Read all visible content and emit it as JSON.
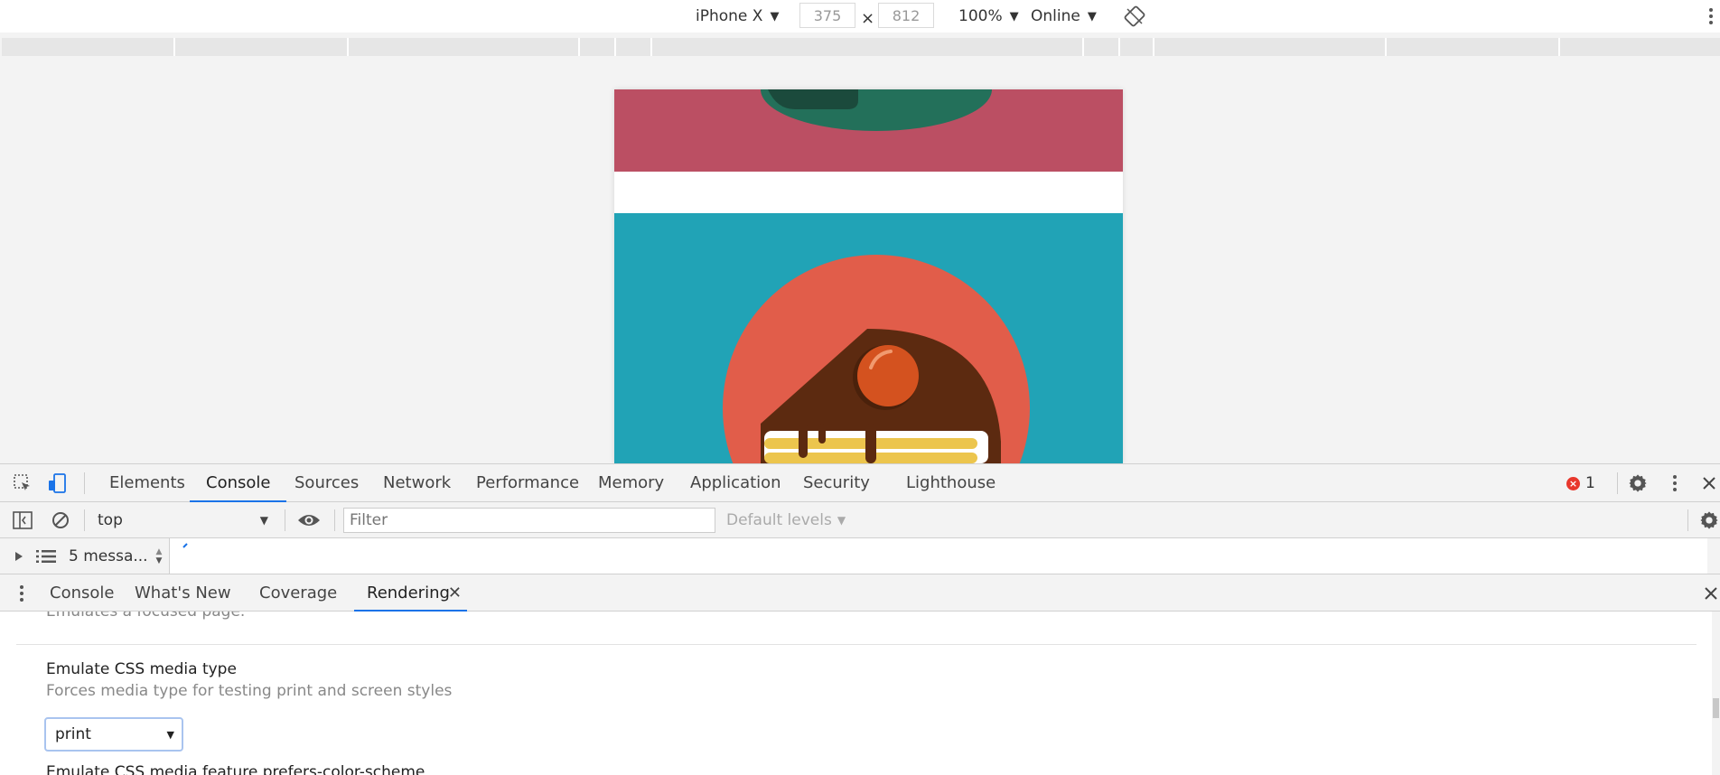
{
  "device_toolbar": {
    "device": "iPhone X",
    "width": "375",
    "times": "×",
    "height": "812",
    "zoom": "100%",
    "network": "Online"
  },
  "main_tabs": [
    "Elements",
    "Console",
    "Sources",
    "Network",
    "Performance",
    "Memory",
    "Application",
    "Security",
    "Lighthouse"
  ],
  "active_main_tab": "Console",
  "error_count": "1",
  "console_toolbar": {
    "context": "top",
    "filter_placeholder": "Filter",
    "levels": "Default levels"
  },
  "messages_label": "5 messa...",
  "drawer_tabs": [
    "Console",
    "What's New",
    "Coverage",
    "Rendering"
  ],
  "active_drawer_tab": "Rendering",
  "rendering": {
    "clipped_text": "Emulates a focused page.",
    "media_type_title": "Emulate CSS media type",
    "media_type_desc": "Forces media type for testing print and screen styles",
    "media_type_value": "print",
    "next_title": "Emulate CSS media feature prefers-color-scheme"
  },
  "colors": {
    "accent": "#1a73e8",
    "page_crimson": "#bb4f63",
    "page_teal": "#21a3b6",
    "page_coral": "#e15d4a",
    "page_chocolate": "#5c2a10",
    "page_orange": "#d4521f",
    "page_yellow": "#ecc54d",
    "page_green": "#23705a",
    "error_red": "#e8372c"
  }
}
